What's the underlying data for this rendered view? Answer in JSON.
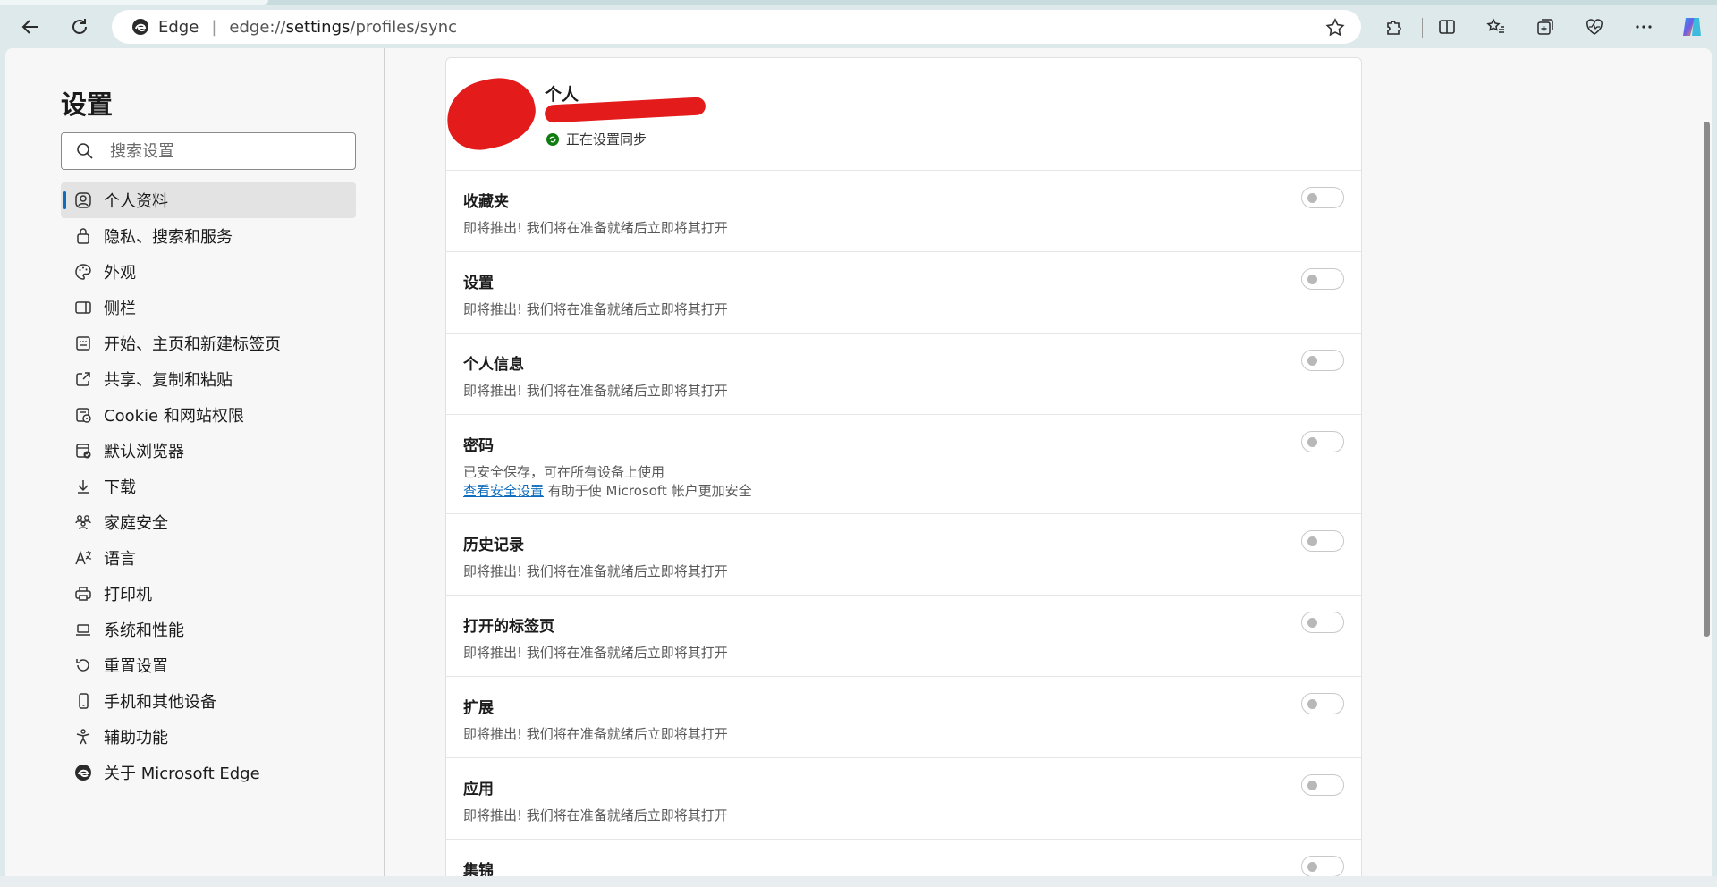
{
  "address_bar": {
    "brand": "Edge",
    "separator": "|",
    "url_prefix": "edge://",
    "url_bold": "settings",
    "url_rest": "/profiles/sync"
  },
  "sidebar": {
    "title": "设置",
    "search_placeholder": "搜索设置",
    "items": [
      {
        "label": "个人资料",
        "icon": "profile-icon",
        "active": true
      },
      {
        "label": "隐私、搜索和服务",
        "icon": "lock-icon"
      },
      {
        "label": "外观",
        "icon": "palette-icon"
      },
      {
        "label": "侧栏",
        "icon": "sidebar-icon"
      },
      {
        "label": "开始、主页和新建标签页",
        "icon": "home-grid-icon"
      },
      {
        "label": "共享、复制和粘贴",
        "icon": "share-icon"
      },
      {
        "label": "Cookie 和网站权限",
        "icon": "cookie-icon"
      },
      {
        "label": "默认浏览器",
        "icon": "browser-check-icon"
      },
      {
        "label": "下载",
        "icon": "download-icon"
      },
      {
        "label": "家庭安全",
        "icon": "family-icon"
      },
      {
        "label": "语言",
        "icon": "language-icon"
      },
      {
        "label": "打印机",
        "icon": "printer-icon"
      },
      {
        "label": "系统和性能",
        "icon": "laptop-icon"
      },
      {
        "label": "重置设置",
        "icon": "reset-icon"
      },
      {
        "label": "手机和其他设备",
        "icon": "phone-icon"
      },
      {
        "label": "辅助功能",
        "icon": "accessibility-icon"
      },
      {
        "label": "关于 Microsoft Edge",
        "icon": "edge-logo-icon"
      }
    ]
  },
  "profile": {
    "name": "个人",
    "sync_status": "正在设置同步"
  },
  "sync_items": [
    {
      "title": "收藏夹",
      "desc": "即将推出! 我们将在准备就绪后立即将其打开"
    },
    {
      "title": "设置",
      "desc": "即将推出! 我们将在准备就绪后立即将其打开"
    },
    {
      "title": "个人信息",
      "desc": "即将推出! 我们将在准备就绪后立即将其打开"
    },
    {
      "title": "密码",
      "desc": "已安全保存，可在所有设备上使用",
      "link": "查看安全设置",
      "link_suffix": " 有助于使 Microsoft 帐户更加安全"
    },
    {
      "title": "历史记录",
      "desc": "即将推出! 我们将在准备就绪后立即将其打开"
    },
    {
      "title": "打开的标签页",
      "desc": "即将推出! 我们将在准备就绪后立即将其打开"
    },
    {
      "title": "扩展",
      "desc": "即将推出! 我们将在准备就绪后立即将其打开"
    },
    {
      "title": "应用",
      "desc": "即将推出! 我们将在准备就绪后立即将其打开"
    },
    {
      "title": "集锦",
      "desc": ""
    }
  ],
  "colors": {
    "accent": "#0f6cbd",
    "sync_green": "#107c10",
    "redaction": "#e31b1b"
  }
}
